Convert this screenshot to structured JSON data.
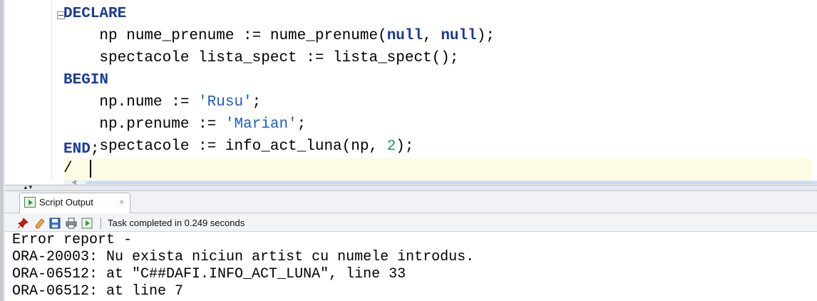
{
  "editor": {
    "lines": [
      {
        "kw": "DECLARE"
      },
      {
        "pre": "    np nume_prenume := nume_prenume(",
        "kw1": "null",
        "mid": ", ",
        "kw2": "null",
        "post": ");"
      },
      {
        "text": "    spectacole lista_spect := lista_spect();"
      },
      {
        "kw": "BEGIN"
      },
      {
        "pre": "    np.nume := ",
        "str": "'Rusu'",
        "post": ";"
      },
      {
        "pre": "    np.prenume := ",
        "str": "'Marian'",
        "post": ";"
      },
      {
        "pre": "    spectacole := info_act_luna(np, ",
        "num": "2",
        "post": ");"
      },
      {
        "kw": "END",
        "post": ";"
      },
      {
        "text": "/"
      }
    ]
  },
  "panel": {
    "tab_label": "Script Output",
    "tab_close": "×",
    "status": "Task completed in 0.249 seconds",
    "toolbar_icons": [
      "pin-icon",
      "eraser-icon",
      "save-icon",
      "print-icon",
      "run-script-icon"
    ]
  },
  "output": {
    "lines": [
      "Error report -",
      "ORA-20003: Nu exista niciun artist cu numele introdus.",
      "ORA-06512: at \"C##DAFI.INFO_ACT_LUNA\", line 33",
      "ORA-06512: at line 7"
    ]
  },
  "colors": {
    "keyword": "#1a3a9a",
    "string": "#1a5fc8",
    "number": "#1f9a45",
    "current_line": "#fdfce3"
  }
}
